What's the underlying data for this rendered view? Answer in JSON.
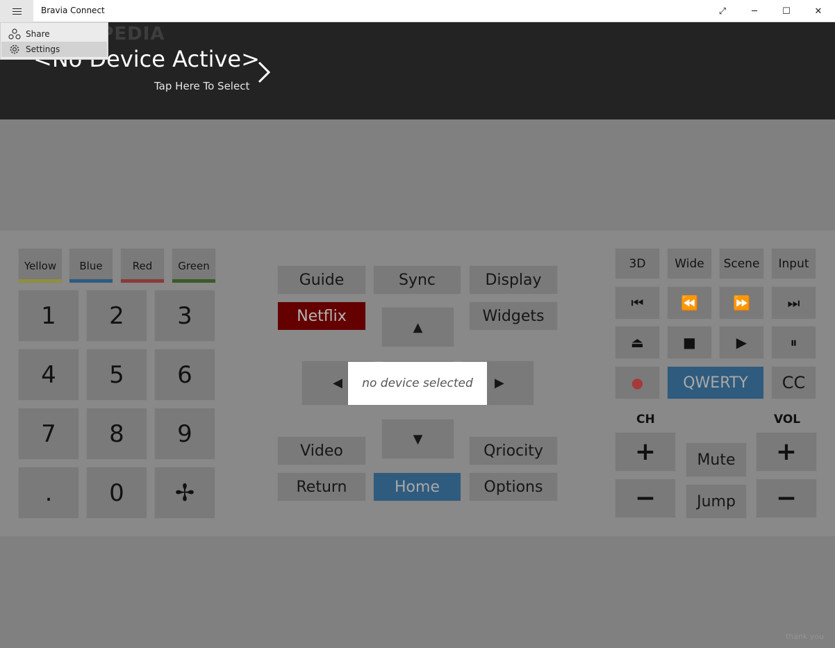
{
  "window": {
    "title": "Bravia Connect",
    "controls": {
      "fullscreen": "⤢",
      "minimize": "─",
      "maximize": "☐",
      "close": "✕"
    }
  },
  "menu": {
    "items": [
      {
        "label": "Share",
        "icon": "share-icon"
      },
      {
        "label": "Settings",
        "icon": "gear-icon"
      }
    ]
  },
  "watermark": "SOFTPEDIA",
  "device": {
    "title": "<No Device Active>",
    "subtitle": "Tap Here To Select"
  },
  "color_buttons": [
    {
      "label": "Yellow",
      "color": "#8f8f3c"
    },
    {
      "label": "Blue",
      "color": "#2f5b7e"
    },
    {
      "label": "Red",
      "color": "#8a3a3a"
    },
    {
      "label": "Green",
      "color": "#3a5a2a"
    }
  ],
  "numpad": [
    "1",
    "2",
    "3",
    "4",
    "5",
    "6",
    "7",
    "8",
    "9",
    ".",
    "0",
    "✢"
  ],
  "nav": {
    "guide": "Guide",
    "sync": "Sync",
    "display": "Display",
    "netflix": "Netflix",
    "widgets": "Widgets",
    "video": "Video",
    "qriocity": "Qriocity",
    "return": "Return",
    "home": "Home",
    "options": "Options",
    "up": "▲",
    "down": "▼",
    "left": "◀",
    "right": "▶"
  },
  "toast": "no device selected",
  "tools": {
    "three_d": "3D",
    "wide": "Wide",
    "scene": "Scene",
    "input": "Input"
  },
  "media": {
    "skip_back": "⏮",
    "rewind": "⏪",
    "fast_forward": "⏩",
    "skip_forward": "⏭",
    "eject": "⏏",
    "stop": "■",
    "play": "▶",
    "pause": "⏸",
    "record": "●",
    "qwerty": "QWERTY",
    "cc": "CC"
  },
  "channel": {
    "label": "CH",
    "up": "+",
    "down": "−"
  },
  "volume": {
    "label": "VOL",
    "up": "+",
    "down": "−"
  },
  "mute": "Mute",
  "jump": "Jump",
  "footer": "thank you",
  "colors": {
    "header_bg": "#232323",
    "overlay_bg": "#808080",
    "netflix_red": "#640000",
    "home_blue": "#2f5b7e",
    "record_red": "#a63a3a"
  }
}
